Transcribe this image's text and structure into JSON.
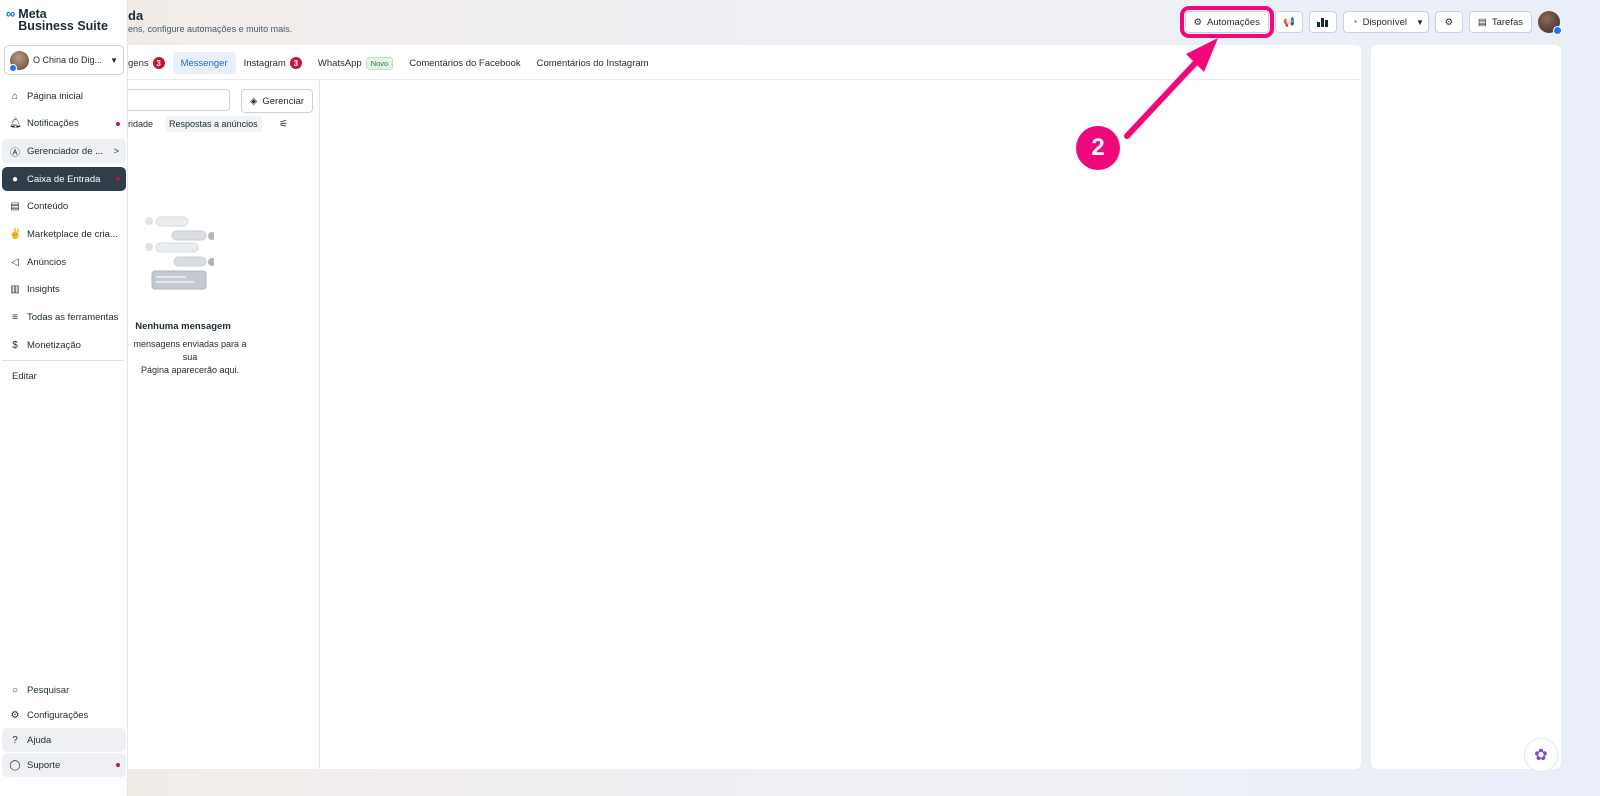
{
  "header": {
    "title": "da",
    "subtitle": "ens, configure automações e muito mais.",
    "automations_label": "Automações",
    "status_label": "Disponível",
    "tasks_label": "Tarefas"
  },
  "sidebar": {
    "logo_line1": "Meta",
    "logo_line2": "Business Suite",
    "account_name": "O China do Dig...",
    "items": [
      {
        "label": "Página inicial",
        "icon": "home-icon"
      },
      {
        "label": "Notificações",
        "icon": "bell-icon"
      },
      {
        "label": "Gerenciador de ...",
        "icon": "ads-manager-icon"
      },
      {
        "label": "Caixa de Entrada",
        "icon": "inbox-icon"
      },
      {
        "label": "Conteúdo",
        "icon": "content-icon"
      },
      {
        "label": "Marketplace de cria...",
        "icon": "handshake-icon"
      },
      {
        "label": "Anúncios",
        "icon": "megaphone-icon"
      },
      {
        "label": "Insights",
        "icon": "chart-icon"
      },
      {
        "label": "Todas as ferramentas",
        "icon": "menu-icon"
      },
      {
        "label": "Monetização",
        "icon": "dollar-icon"
      }
    ],
    "edit_label": "Editar",
    "bottom_items": [
      {
        "label": "Pesquisar",
        "icon": "search-icon"
      },
      {
        "label": "Configurações",
        "icon": "gear-icon"
      },
      {
        "label": "Ajuda",
        "icon": "help-icon"
      },
      {
        "label": "Suporte",
        "icon": "support-icon"
      }
    ]
  },
  "tabs": [
    {
      "label": "gens",
      "badge": "3"
    },
    {
      "label": "Messenger"
    },
    {
      "label": "Instagram",
      "badge": "3"
    },
    {
      "label": "WhatsApp",
      "tag": "Novo"
    },
    {
      "label": "Comentários do Facebook"
    },
    {
      "label": "Comentários do Instagram"
    }
  ],
  "list": {
    "manage_label": "Gerenciar",
    "filter_priority": "ridade",
    "filter_ads": "Respostas a anúncios",
    "empty_title": "Nenhuma mensagem",
    "empty_desc_line1": "mensagens enviadas para a sua",
    "empty_desc_line2": "Página aparecerão aqui."
  },
  "annotation": {
    "step_number": "2",
    "color": "#f0087a"
  }
}
